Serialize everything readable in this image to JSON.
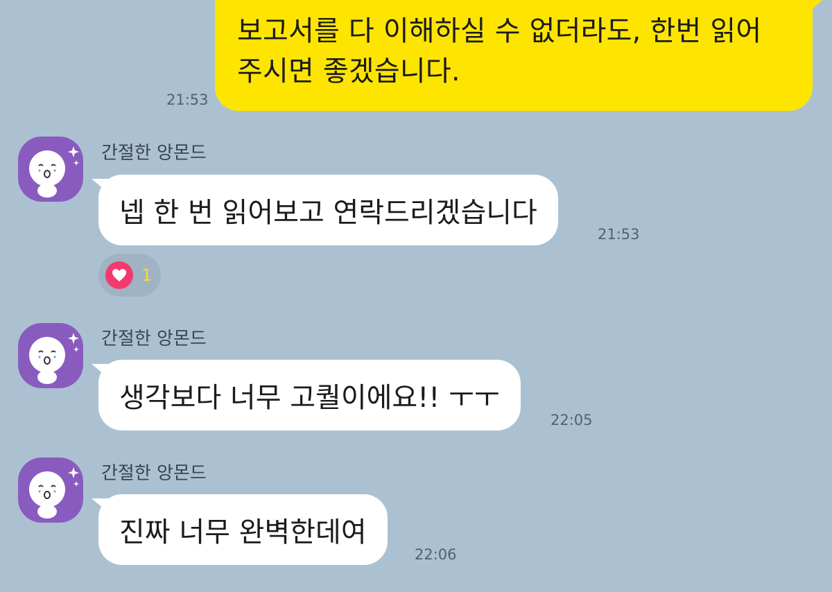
{
  "outgoing": {
    "text": "보고서를 다 이해하실 수 없더라도, 한번 읽어\n주시면 좋겠습니다.",
    "time": "21:53",
    "bubble_color": "#fee500"
  },
  "messages": [
    {
      "sender": "간절한 앙몬드",
      "text": "넵 한 번 읽어보고 연락드리겠습니다",
      "time": "21:53",
      "reaction": {
        "icon": "heart-icon",
        "count": "1"
      }
    },
    {
      "sender": "간절한 앙몬드",
      "text": "생각보다 너무 고퀄이에요!! ㅜㅜ",
      "time": "22:05"
    },
    {
      "sender": "간절한 앙몬드",
      "text": "진짜 너무 완벽한데여",
      "time": "22:06"
    }
  ],
  "colors": {
    "background": "#abc1d1",
    "avatar": "#8a5bbf",
    "reaction_heart": "#f33a6f"
  }
}
